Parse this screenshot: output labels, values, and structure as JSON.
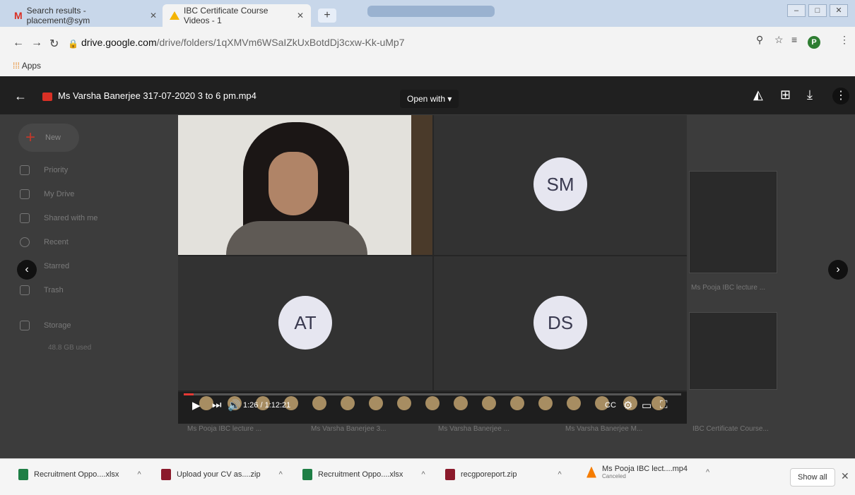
{
  "browser": {
    "tabs": [
      {
        "label": "Search results - placement@sym",
        "icon": "gmail-icon"
      },
      {
        "label": "IBC Certificate Course Videos - 1",
        "icon": "drive-icon"
      }
    ],
    "url_host": "drive.google.com",
    "url_path": "/drive/folders/1qXMVm6WSaIZkUxBotdDj3cxw-Kk-uMp7",
    "apps_label": "Apps",
    "profile_initial": "P"
  },
  "viewer": {
    "file_title": "Ms Varsha Banerjee 317-07-2020 3 to 6 pm.mp4",
    "open_with": "Open with"
  },
  "drive_sidebar": {
    "new_label": "New",
    "items": [
      "Priority",
      "My Drive",
      "Shared with me",
      "Recent",
      "Starred",
      "Trash",
      "Storage"
    ],
    "storage_sub": "48.8 GB used"
  },
  "drive_files": [
    "Ms Pooja IBC lecture ...",
    "Ms Varsha Banerjee 3...",
    "Ms Varsha Banerjee ...",
    "Ms Varsha Banerjee M...",
    "IBC Certificate Course...",
    "Ms Pooja IBC lecture ..."
  ],
  "video": {
    "participants": [
      "SM",
      "AT",
      "DS"
    ],
    "time": "1:26 / 1:12:21",
    "progress_fraction": 0.02
  },
  "downloads": [
    {
      "name": "Recruitment Oppo....xlsx",
      "sub": ""
    },
    {
      "name": "Upload your CV as....zip",
      "sub": ""
    },
    {
      "name": "Recruitment Oppo....xlsx",
      "sub": ""
    },
    {
      "name": "recgporeport.zip",
      "sub": ""
    },
    {
      "name": "Ms Pooja IBC lect....mp4",
      "sub": "Canceled"
    }
  ],
  "show_all": "Show all"
}
